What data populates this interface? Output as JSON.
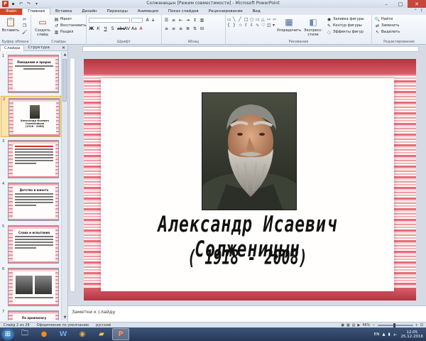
{
  "window": {
    "title": "Солженицын [Режим совместимости] - Microsoft PowerPoint",
    "app_logo": "P"
  },
  "ribbon_tabs": [
    "Файл",
    "Главная",
    "Вставка",
    "Дизайн",
    "Переходы",
    "Анимация",
    "Показ слайдов",
    "Рецензирование",
    "Вид"
  ],
  "ribbon": {
    "clipboard": {
      "label": "Буфер обмена",
      "paste": "Вставить"
    },
    "slides": {
      "label": "Слайды",
      "new_slide": "Создать слайд",
      "layout": "Макет",
      "reset": "Восстановить",
      "section": "Раздел"
    },
    "font": {
      "label": "Шрифт",
      "font_name": "",
      "font_size": ""
    },
    "paragraph": {
      "label": "Абзац"
    },
    "drawing": {
      "label": "Рисование",
      "arrange": "Упорядочить",
      "quick_styles": "Экспресс-стили",
      "fill": "Заливка фигуры",
      "outline": "Контур фигуры",
      "effects": "Эффекты фигур"
    },
    "editing": {
      "label": "Редактирование",
      "find": "Найти",
      "replace": "Заменить",
      "select": "Выделить"
    }
  },
  "left_pane": {
    "tabs": [
      "Слайды",
      "Структура"
    ],
    "thumbnails": [
      {
        "num": "1",
        "title": "Поведение и пророк"
      },
      {
        "num": "2",
        "title": "Александр Исаевич Солженицын",
        "sub": "(1918 - 2008)"
      },
      {
        "num": "3",
        "title": ""
      },
      {
        "num": "4",
        "title": "Детство и юность"
      },
      {
        "num": "5",
        "title": "Слава и испытания"
      },
      {
        "num": "6",
        "title": ""
      },
      {
        "num": "7",
        "title": "По архипелагу"
      }
    ]
  },
  "slide": {
    "name": "Александр Исаевич Солженицын",
    "years": "( 1918 - 2008)"
  },
  "notes": {
    "placeholder": "Заметки к слайду"
  },
  "status": {
    "slide_of": "Слайд 2 из 28",
    "theme": "Оформление по умолчанию",
    "language": "русский",
    "zoom": "46%"
  },
  "taskbar": {
    "lang": "EN",
    "time": "12:05",
    "date": "25.12.2016"
  }
}
